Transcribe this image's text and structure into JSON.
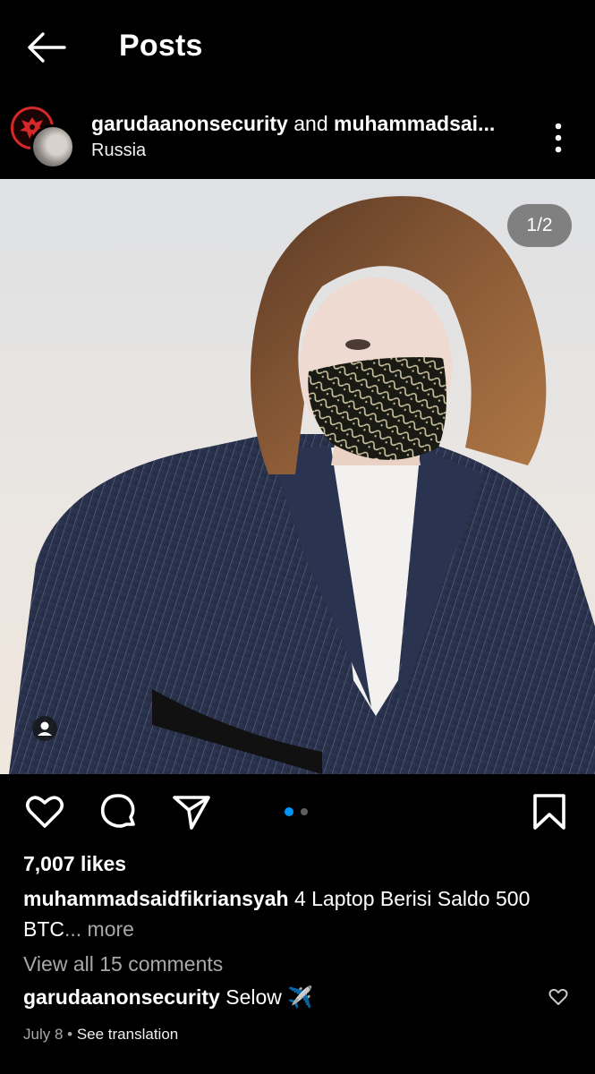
{
  "header": {
    "title": "Posts",
    "back_icon": "arrow-left-icon"
  },
  "post": {
    "author": "garudaanonsecurity",
    "joiner": " and ",
    "coauthor": "muhammadsai...",
    "location": "Russia",
    "options_icon": "more-vertical-icon",
    "media_counter": "1/2",
    "media_index": 1,
    "media_total": 2,
    "likes": "7,007 likes",
    "caption_user": "muhammadsaidfikriansyah",
    "caption_text": " 4 Laptop Berisi Saldo 500 BTC",
    "caption_more": "... more",
    "view_comments": "View all 15 comments",
    "comment_user": "garudaanonsecurity",
    "comment_text": " Selow ✈️",
    "date": "July 8",
    "separator": " • ",
    "see_translation": "See translation"
  },
  "actions": {
    "like_icon": "heart-icon",
    "comment_icon": "comment-icon",
    "share_icon": "send-icon",
    "save_icon": "bookmark-icon"
  },
  "colors": {
    "background": "#000000",
    "text": "#ffffff",
    "muted": "#a8a8a8",
    "active_dot": "#0095f6",
    "inactive_dot": "#5e5e5e",
    "avatar_ring": "#d62828"
  }
}
